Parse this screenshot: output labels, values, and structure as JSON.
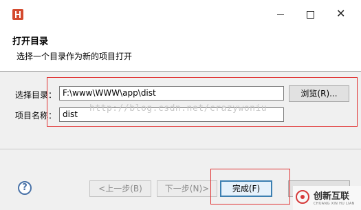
{
  "window": {
    "app_icon": "hbuilder-h-icon",
    "controls": {
      "minimize": "minimize-icon",
      "maximize": "maximize-icon",
      "close": "close-icon"
    }
  },
  "header": {
    "title": "打开目录",
    "subtitle": "选择一个目录作为新的项目打开"
  },
  "form": {
    "dir_label": "选择目录：",
    "dir_value": "F:\\www\\WWW\\app\\dist",
    "browse_label": "浏览(R)...",
    "name_label": "项目名称：",
    "name_value": "dist",
    "watermark": "http://blog.csdn.net/crazywoniu"
  },
  "footer": {
    "help_glyph": "?",
    "back_label": "<上一步(B)",
    "next_label": "下一步(N)>",
    "finish_label": "完成(F)",
    "cancel_label": ""
  },
  "logo": {
    "text": "创新互联",
    "subtext": "CHUANG XIN HU LIAN"
  },
  "colors": {
    "highlight": "#e03030",
    "focus_border": "#3c7fb1",
    "help": "#4a73a8"
  }
}
